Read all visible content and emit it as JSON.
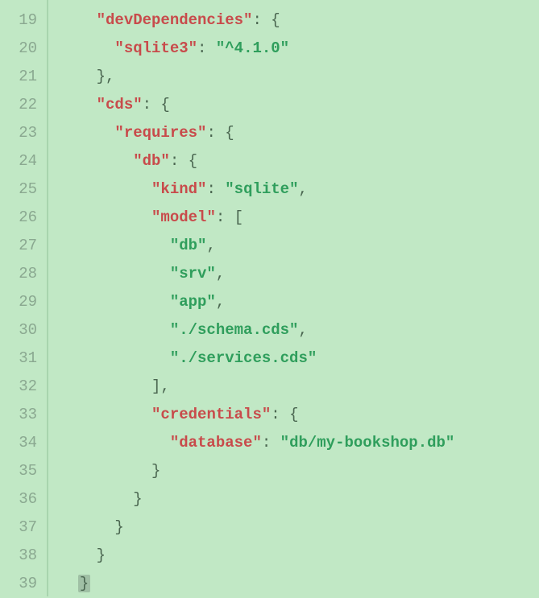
{
  "lineNumbers": [
    "19",
    "20",
    "21",
    "22",
    "23",
    "24",
    "25",
    "26",
    "27",
    "28",
    "29",
    "30",
    "31",
    "32",
    "33",
    "34",
    "35",
    "36",
    "37",
    "38",
    "39"
  ],
  "code": {
    "l19": {
      "indent": "    ",
      "key": "\"devDependencies\"",
      "after": ": {"
    },
    "l20": {
      "indent": "      ",
      "key": "\"sqlite3\"",
      "colon": ": ",
      "val": "\"^4.1.0\""
    },
    "l21": {
      "indent": "    ",
      "text": "},"
    },
    "l22": {
      "indent": "    ",
      "key": "\"cds\"",
      "after": ": {"
    },
    "l23": {
      "indent": "      ",
      "key": "\"requires\"",
      "after": ": {"
    },
    "l24": {
      "indent": "        ",
      "key": "\"db\"",
      "after": ": {"
    },
    "l25": {
      "indent": "          ",
      "key": "\"kind\"",
      "colon": ": ",
      "val": "\"sqlite\"",
      "comma": ","
    },
    "l26": {
      "indent": "          ",
      "key": "\"model\"",
      "after": ": ["
    },
    "l27": {
      "indent": "            ",
      "val": "\"db\"",
      "comma": ","
    },
    "l28": {
      "indent": "            ",
      "val": "\"srv\"",
      "comma": ","
    },
    "l29": {
      "indent": "            ",
      "val": "\"app\"",
      "comma": ","
    },
    "l30": {
      "indent": "            ",
      "val": "\"./schema.cds\"",
      "comma": ","
    },
    "l31": {
      "indent": "            ",
      "val": "\"./services.cds\""
    },
    "l32": {
      "indent": "          ",
      "text": "],"
    },
    "l33": {
      "indent": "          ",
      "key": "\"credentials\"",
      "after": ": {"
    },
    "l34": {
      "indent": "            ",
      "key": "\"database\"",
      "colon": ": ",
      "val": "\"db/my-bookshop.db\""
    },
    "l35": {
      "indent": "          ",
      "text": "}"
    },
    "l36": {
      "indent": "        ",
      "text": "}"
    },
    "l37": {
      "indent": "      ",
      "text": "}"
    },
    "l38": {
      "indent": "    ",
      "text": "}"
    },
    "l39": {
      "indent": "  ",
      "text": "}"
    }
  }
}
